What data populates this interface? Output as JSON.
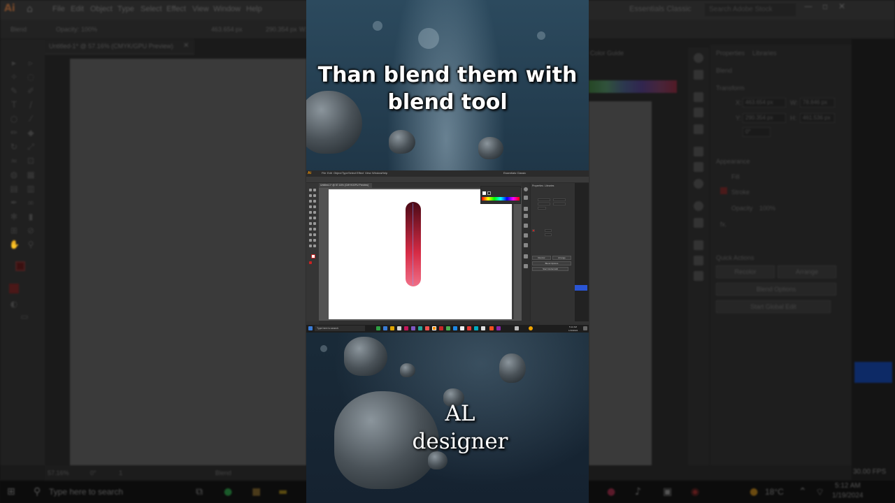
{
  "captions": {
    "top": "Than blend them with blend tool",
    "bottom": "AL designer"
  },
  "background_app": {
    "logo": "Ai",
    "menu": [
      "File",
      "Edit",
      "Object",
      "Type",
      "Select",
      "Effect",
      "View",
      "Window",
      "Help"
    ],
    "workspace": "Essentials Classic",
    "search_placeholder": "Search Adobe Stock",
    "option_bar": {
      "mode": "Blend",
      "opacity_label": "Opacity:",
      "opacity_value": "100%",
      "x_value": "463.654 px",
      "y_value": "290.354 px",
      "w_label": "W:"
    },
    "doc_tab": "Untitled-1* @ 57.16% (CMYK/GPU Preview)",
    "status": {
      "zoom": "57.16%",
      "rotate": "0°",
      "artboard": "1",
      "tool": "Blend"
    },
    "color_guide_tab": "Color Guide",
    "properties": {
      "tabs": [
        "Properties",
        "Libraries"
      ],
      "object": "Blend",
      "transform_title": "Transform",
      "x_label": "X:",
      "x": "463.654 px",
      "y_label": "Y:",
      "y": "290.354 px",
      "w_label": "W:",
      "w": "78.846 px",
      "h_label": "H:",
      "h": "461.536 px",
      "angle": "0°",
      "appearance_title": "Appearance",
      "fill_label": "Fill",
      "stroke_label": "Stroke",
      "opacity_label": "Opacity",
      "opacity": "100%",
      "fx": "fx.",
      "quick_actions_title": "Quick Actions",
      "buttons": [
        "Recolor",
        "Arrange",
        "Blend Options",
        "Start Global Edit"
      ]
    },
    "fps": "30.00 FPS",
    "taskbar": {
      "search": "Type here to search",
      "weather": "18°C",
      "time": "5:12 AM",
      "date": "1/19/2024"
    }
  },
  "inset_app": {
    "logo": "Ai",
    "menu": [
      "File",
      "Edit",
      "Object",
      "Type",
      "Select",
      "Effect",
      "View",
      "Window",
      "Help"
    ],
    "workspace": "Essentials Classic",
    "doc_tab": "Untitled-1* @ 57.16% (CMYK/GPU Preview)",
    "properties_tabs": [
      "Properties",
      "Libraries"
    ],
    "buttons": [
      "Recolor",
      "Arrange",
      "Blend Options",
      "Start Global Edit"
    ],
    "taskbar_search": "Type here to search",
    "time": "5:12 AM",
    "date": "1/19/2024",
    "blend_object_colors": {
      "top": "#4a0a16",
      "mid": "#d62b45",
      "bottom": "#f07088"
    }
  }
}
